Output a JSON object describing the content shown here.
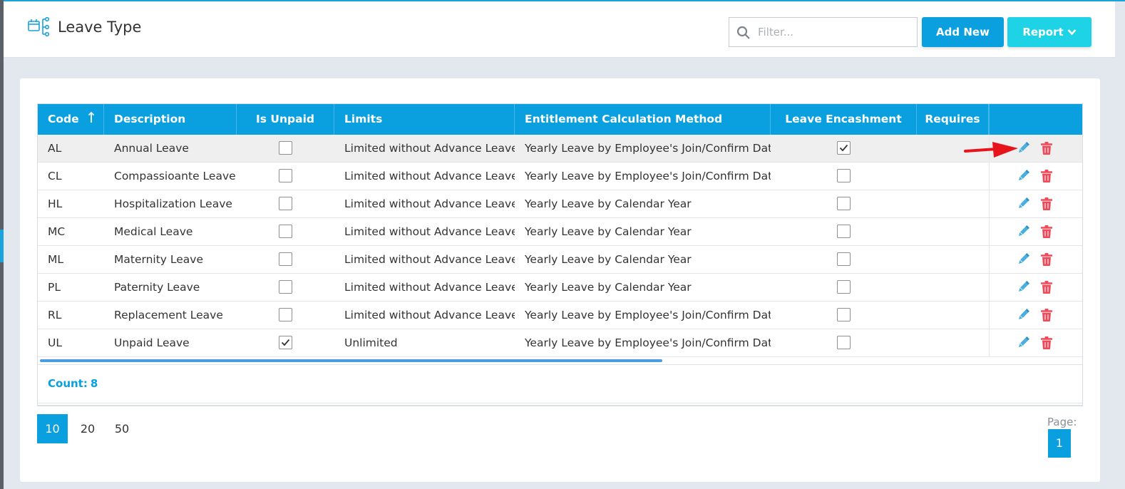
{
  "header": {
    "title": "Leave Type",
    "icon": "leave-type-icon",
    "filter_placeholder": "Filter...",
    "add_label": "Add New",
    "report_label": "Report"
  },
  "colors": {
    "accent": "#0aa0e0",
    "report": "#1fd3e6",
    "delete": "#f04a5a",
    "edit": "#4aaee0",
    "annotation_arrow": "#e8141c"
  },
  "table": {
    "columns": [
      "Code",
      "Description",
      "Is Unpaid",
      "Limits",
      "Entitlement Calculation Method",
      "Leave Encashment",
      "Requires"
    ],
    "sort": {
      "column": "Code",
      "direction": "ascending"
    },
    "rows": [
      {
        "code": "AL",
        "description": "Annual Leave",
        "is_unpaid": false,
        "limits": "Limited without Advance Leave",
        "method": "Yearly Leave by Employee's Join/Confirm Date",
        "encashment": true
      },
      {
        "code": "CL",
        "description": "Compassioante Leave",
        "is_unpaid": false,
        "limits": "Limited without Advance Leave",
        "method": "Yearly Leave by Employee's Join/Confirm Date",
        "encashment": false
      },
      {
        "code": "HL",
        "description": "Hospitalization Leave",
        "is_unpaid": false,
        "limits": "Limited without Advance Leave",
        "method": "Yearly Leave by Calendar Year",
        "encashment": false
      },
      {
        "code": "MC",
        "description": "Medical Leave",
        "is_unpaid": false,
        "limits": "Limited without Advance Leave",
        "method": "Yearly Leave by Calendar Year",
        "encashment": false
      },
      {
        "code": "ML",
        "description": "Maternity Leave",
        "is_unpaid": false,
        "limits": "Limited without Advance Leave",
        "method": "Yearly Leave by Calendar Year",
        "encashment": false
      },
      {
        "code": "PL",
        "description": "Paternity Leave",
        "is_unpaid": false,
        "limits": "Limited without Advance Leave",
        "method": "Yearly Leave by Calendar Year",
        "encashment": false
      },
      {
        "code": "RL",
        "description": "Replacement Leave",
        "is_unpaid": false,
        "limits": "Limited without Advance Leave",
        "method": "Yearly Leave by Employee's Join/Confirm Date",
        "encashment": false
      },
      {
        "code": "UL",
        "description": "Unpaid Leave",
        "is_unpaid": true,
        "limits": "Unlimited",
        "method": "Yearly Leave by Employee's Join/Confirm Date",
        "encashment": false
      }
    ],
    "row_icons": [
      "pencil-icon",
      "trash-icon"
    ],
    "count_label": "Count:",
    "count_value": "8"
  },
  "pagination": {
    "page_sizes": [
      "10",
      "20",
      "50"
    ],
    "active_page_size": "10",
    "page_label": "Page:",
    "current_page": "1"
  }
}
